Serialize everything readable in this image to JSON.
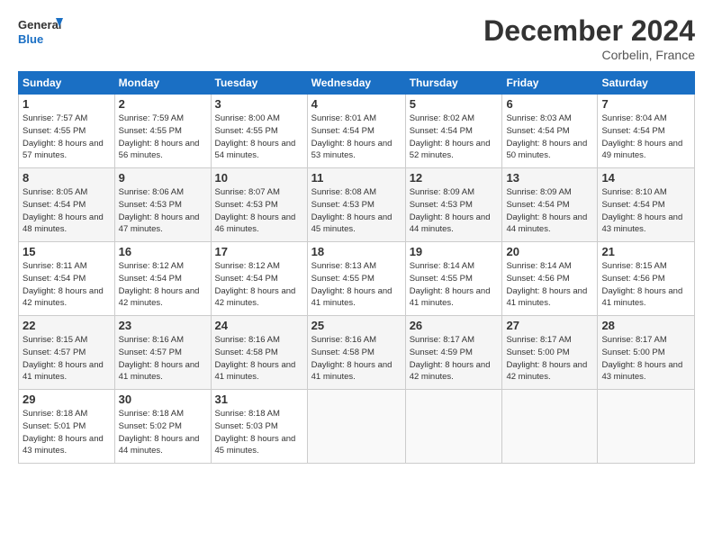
{
  "logo": {
    "line1": "General",
    "line2": "Blue"
  },
  "title": "December 2024",
  "location": "Corbelin, France",
  "header_days": [
    "Sunday",
    "Monday",
    "Tuesday",
    "Wednesday",
    "Thursday",
    "Friday",
    "Saturday"
  ],
  "weeks": [
    [
      {
        "day": "1",
        "sunrise": "Sunrise: 7:57 AM",
        "sunset": "Sunset: 4:55 PM",
        "daylight": "Daylight: 8 hours and 57 minutes."
      },
      {
        "day": "2",
        "sunrise": "Sunrise: 7:59 AM",
        "sunset": "Sunset: 4:55 PM",
        "daylight": "Daylight: 8 hours and 56 minutes."
      },
      {
        "day": "3",
        "sunrise": "Sunrise: 8:00 AM",
        "sunset": "Sunset: 4:55 PM",
        "daylight": "Daylight: 8 hours and 54 minutes."
      },
      {
        "day": "4",
        "sunrise": "Sunrise: 8:01 AM",
        "sunset": "Sunset: 4:54 PM",
        "daylight": "Daylight: 8 hours and 53 minutes."
      },
      {
        "day": "5",
        "sunrise": "Sunrise: 8:02 AM",
        "sunset": "Sunset: 4:54 PM",
        "daylight": "Daylight: 8 hours and 52 minutes."
      },
      {
        "day": "6",
        "sunrise": "Sunrise: 8:03 AM",
        "sunset": "Sunset: 4:54 PM",
        "daylight": "Daylight: 8 hours and 50 minutes."
      },
      {
        "day": "7",
        "sunrise": "Sunrise: 8:04 AM",
        "sunset": "Sunset: 4:54 PM",
        "daylight": "Daylight: 8 hours and 49 minutes."
      }
    ],
    [
      {
        "day": "8",
        "sunrise": "Sunrise: 8:05 AM",
        "sunset": "Sunset: 4:54 PM",
        "daylight": "Daylight: 8 hours and 48 minutes."
      },
      {
        "day": "9",
        "sunrise": "Sunrise: 8:06 AM",
        "sunset": "Sunset: 4:53 PM",
        "daylight": "Daylight: 8 hours and 47 minutes."
      },
      {
        "day": "10",
        "sunrise": "Sunrise: 8:07 AM",
        "sunset": "Sunset: 4:53 PM",
        "daylight": "Daylight: 8 hours and 46 minutes."
      },
      {
        "day": "11",
        "sunrise": "Sunrise: 8:08 AM",
        "sunset": "Sunset: 4:53 PM",
        "daylight": "Daylight: 8 hours and 45 minutes."
      },
      {
        "day": "12",
        "sunrise": "Sunrise: 8:09 AM",
        "sunset": "Sunset: 4:53 PM",
        "daylight": "Daylight: 8 hours and 44 minutes."
      },
      {
        "day": "13",
        "sunrise": "Sunrise: 8:09 AM",
        "sunset": "Sunset: 4:54 PM",
        "daylight": "Daylight: 8 hours and 44 minutes."
      },
      {
        "day": "14",
        "sunrise": "Sunrise: 8:10 AM",
        "sunset": "Sunset: 4:54 PM",
        "daylight": "Daylight: 8 hours and 43 minutes."
      }
    ],
    [
      {
        "day": "15",
        "sunrise": "Sunrise: 8:11 AM",
        "sunset": "Sunset: 4:54 PM",
        "daylight": "Daylight: 8 hours and 42 minutes."
      },
      {
        "day": "16",
        "sunrise": "Sunrise: 8:12 AM",
        "sunset": "Sunset: 4:54 PM",
        "daylight": "Daylight: 8 hours and 42 minutes."
      },
      {
        "day": "17",
        "sunrise": "Sunrise: 8:12 AM",
        "sunset": "Sunset: 4:54 PM",
        "daylight": "Daylight: 8 hours and 42 minutes."
      },
      {
        "day": "18",
        "sunrise": "Sunrise: 8:13 AM",
        "sunset": "Sunset: 4:55 PM",
        "daylight": "Daylight: 8 hours and 41 minutes."
      },
      {
        "day": "19",
        "sunrise": "Sunrise: 8:14 AM",
        "sunset": "Sunset: 4:55 PM",
        "daylight": "Daylight: 8 hours and 41 minutes."
      },
      {
        "day": "20",
        "sunrise": "Sunrise: 8:14 AM",
        "sunset": "Sunset: 4:56 PM",
        "daylight": "Daylight: 8 hours and 41 minutes."
      },
      {
        "day": "21",
        "sunrise": "Sunrise: 8:15 AM",
        "sunset": "Sunset: 4:56 PM",
        "daylight": "Daylight: 8 hours and 41 minutes."
      }
    ],
    [
      {
        "day": "22",
        "sunrise": "Sunrise: 8:15 AM",
        "sunset": "Sunset: 4:57 PM",
        "daylight": "Daylight: 8 hours and 41 minutes."
      },
      {
        "day": "23",
        "sunrise": "Sunrise: 8:16 AM",
        "sunset": "Sunset: 4:57 PM",
        "daylight": "Daylight: 8 hours and 41 minutes."
      },
      {
        "day": "24",
        "sunrise": "Sunrise: 8:16 AM",
        "sunset": "Sunset: 4:58 PM",
        "daylight": "Daylight: 8 hours and 41 minutes."
      },
      {
        "day": "25",
        "sunrise": "Sunrise: 8:16 AM",
        "sunset": "Sunset: 4:58 PM",
        "daylight": "Daylight: 8 hours and 41 minutes."
      },
      {
        "day": "26",
        "sunrise": "Sunrise: 8:17 AM",
        "sunset": "Sunset: 4:59 PM",
        "daylight": "Daylight: 8 hours and 42 minutes."
      },
      {
        "day": "27",
        "sunrise": "Sunrise: 8:17 AM",
        "sunset": "Sunset: 5:00 PM",
        "daylight": "Daylight: 8 hours and 42 minutes."
      },
      {
        "day": "28",
        "sunrise": "Sunrise: 8:17 AM",
        "sunset": "Sunset: 5:00 PM",
        "daylight": "Daylight: 8 hours and 43 minutes."
      }
    ],
    [
      {
        "day": "29",
        "sunrise": "Sunrise: 8:18 AM",
        "sunset": "Sunset: 5:01 PM",
        "daylight": "Daylight: 8 hours and 43 minutes."
      },
      {
        "day": "30",
        "sunrise": "Sunrise: 8:18 AM",
        "sunset": "Sunset: 5:02 PM",
        "daylight": "Daylight: 8 hours and 44 minutes."
      },
      {
        "day": "31",
        "sunrise": "Sunrise: 8:18 AM",
        "sunset": "Sunset: 5:03 PM",
        "daylight": "Daylight: 8 hours and 45 minutes."
      },
      null,
      null,
      null,
      null
    ]
  ]
}
